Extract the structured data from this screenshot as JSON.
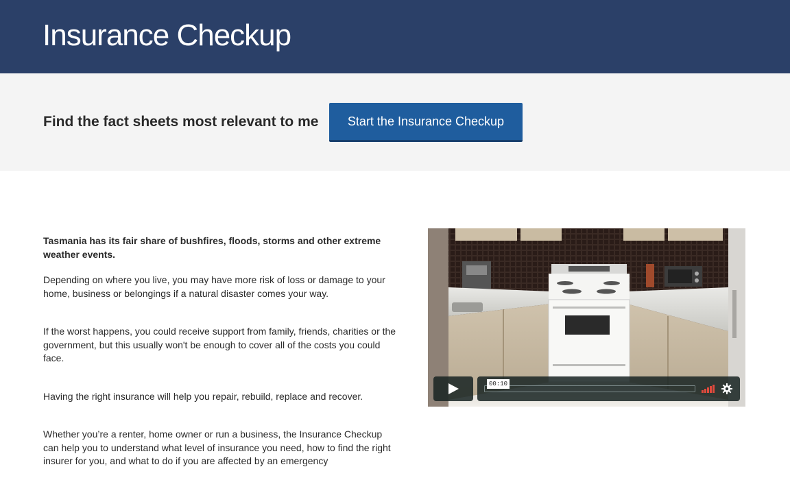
{
  "header": {
    "title": "Insurance Checkup"
  },
  "cta": {
    "text": "Find the fact sheets most relevant to me",
    "button_label": "Start the Insurance Checkup"
  },
  "content": {
    "lead": "Tasmania has its fair share of bushfires, floods, storms and other extreme weather events.",
    "paragraphs": [
      "Depending on where you live, you may have more risk of loss or damage to your home, business or belongings if a natural disaster comes your way.",
      "If the worst happens, you could receive support from family, friends, charities or the government, but this usually won't be enough to cover all of the costs you could face.",
      "Having the right insurance will help you repair, rebuild, replace and recover.",
      "Whether you’re a renter, home owner or run a business, the Insurance Checkup can help you to understand what level of insurance you need, how to find the right insurer for you, and what to do if you are affected by an emergency"
    ]
  },
  "video": {
    "time": "00:10",
    "progress": 0,
    "icons": [
      "play-icon",
      "volume-icon",
      "gear-icon"
    ]
  },
  "colors": {
    "header_bg": "#2b4068",
    "cta_bg": "#f4f4f4",
    "button_bg": "#1f5d9e",
    "volume_accent": "#e04a3d"
  }
}
